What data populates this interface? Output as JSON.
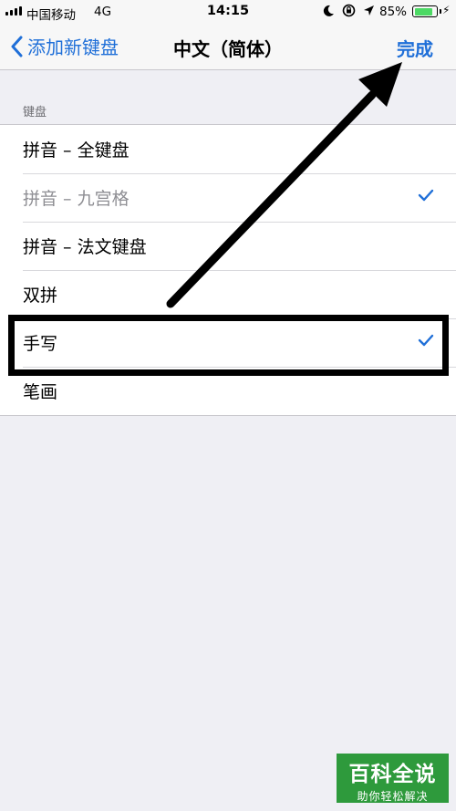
{
  "status": {
    "carrier": "中国移动",
    "network": "4G",
    "time": "14:15",
    "battery": "85%",
    "battery_level": 0.85
  },
  "nav": {
    "back_label": "添加新键盘",
    "title": "中文（简体）",
    "done_label": "完成"
  },
  "section": {
    "header": "键盘",
    "items": [
      {
        "label": "拼音 – 全键盘",
        "checked": false,
        "dimmed": false
      },
      {
        "label": "拼音 – 九宫格",
        "checked": true,
        "dimmed": true
      },
      {
        "label": "拼音 – 法文键盘",
        "checked": false,
        "dimmed": false
      },
      {
        "label": "双拼",
        "checked": false,
        "dimmed": false
      },
      {
        "label": "手写",
        "checked": true,
        "dimmed": false
      },
      {
        "label": "笔画",
        "checked": false,
        "dimmed": false
      }
    ]
  },
  "watermark": {
    "line1": "百科全说",
    "line2": "助你轻松解决"
  },
  "colors": {
    "accent": "#1f6fd8",
    "background": "#efeff4",
    "watermark": "#2e9a3c",
    "battery": "#4cd964"
  }
}
